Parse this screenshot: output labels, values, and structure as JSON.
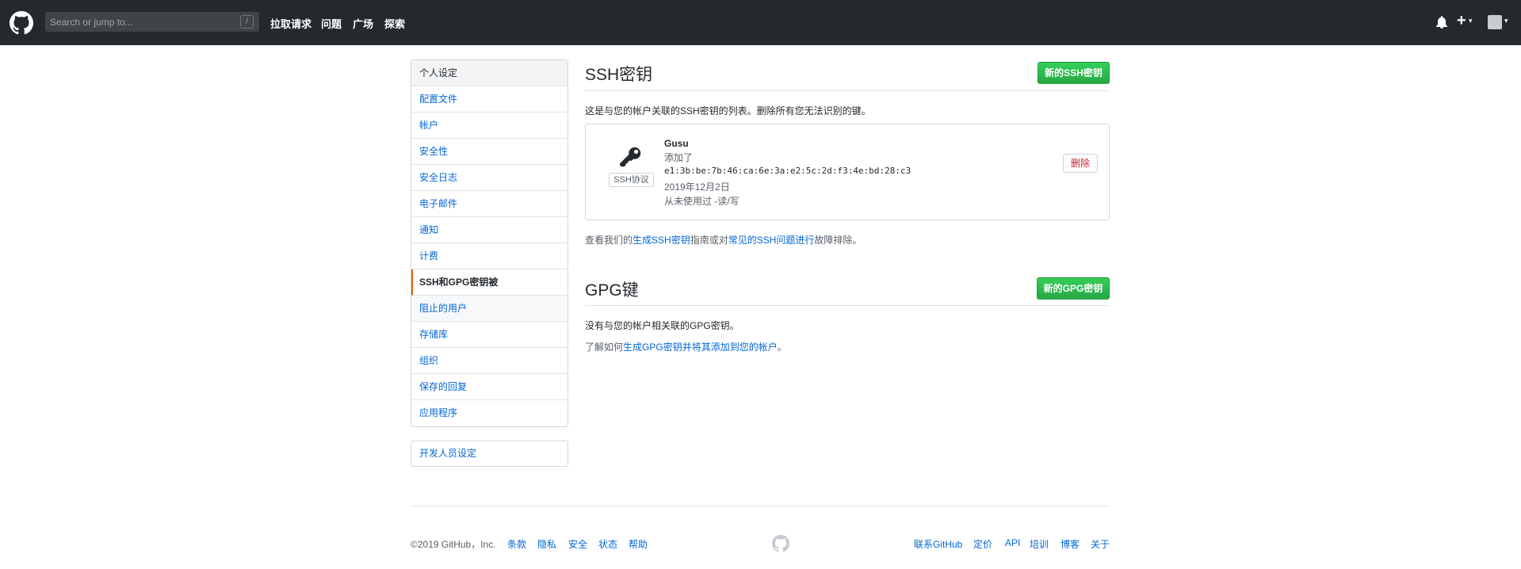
{
  "header": {
    "search_placeholder": "Search or jump to...",
    "slash_hint": "/",
    "nav": [
      "拉取请求",
      "问题",
      "广场",
      "探索"
    ],
    "plus_label": "+",
    "caret": "▾"
  },
  "sidebar": {
    "heading": "个人设定",
    "items": [
      "配置文件",
      "帐户",
      "安全性",
      "安全日志",
      "电子邮件",
      "通知",
      "计费",
      "SSH和GPG密钥被",
      "阻止的用户",
      "存储库",
      "组织",
      "保存的回复",
      "应用程序"
    ],
    "active_index": 7,
    "developer": "开发人员设定"
  },
  "ssh": {
    "title": "SSH密钥",
    "new_button": "新的SSH密钥",
    "description": "这是与您的帐户关联的SSH密钥的列表。删除所有您无法识别的键。",
    "key": {
      "name": "Gusu",
      "added_label": "添加了",
      "fingerprint": "e1:3b:be:7b:46:ca:6e:3a:e2:5c:2d:f3:4e:bd:28:c3",
      "date": "2019年12月2日",
      "usage": "从未使用过 -读/写",
      "type_label": "SSH协议",
      "delete_button": "删除"
    },
    "help_prefix": "查看我们的",
    "help_link1": "生成SSH密钥",
    "help_mid": "指南或对",
    "help_link2": "常见的SSH问题进行",
    "help_suffix": "故障排除。"
  },
  "gpg": {
    "title": "GPG键",
    "new_button": "新的GPG密钥",
    "empty": "没有与您的帐户相关联的GPG密钥。",
    "learn_prefix": "了解如何",
    "learn_link": "生成GPG密钥并将其添加到您的帐户",
    "learn_suffix": "。"
  },
  "footer": {
    "copyright": "©2019 GitHub，Inc.",
    "left_links": [
      "条款",
      "隐私",
      "安全",
      "状态",
      "帮助"
    ],
    "right_links": [
      "联系GitHub",
      "定价",
      "API",
      "培训",
      "博客",
      "关于"
    ]
  },
  "colors": {
    "header_bg": "#24292e",
    "link": "#0366d6",
    "green": "#28a745",
    "active_border": "#e36209",
    "danger": "#cb2431"
  }
}
